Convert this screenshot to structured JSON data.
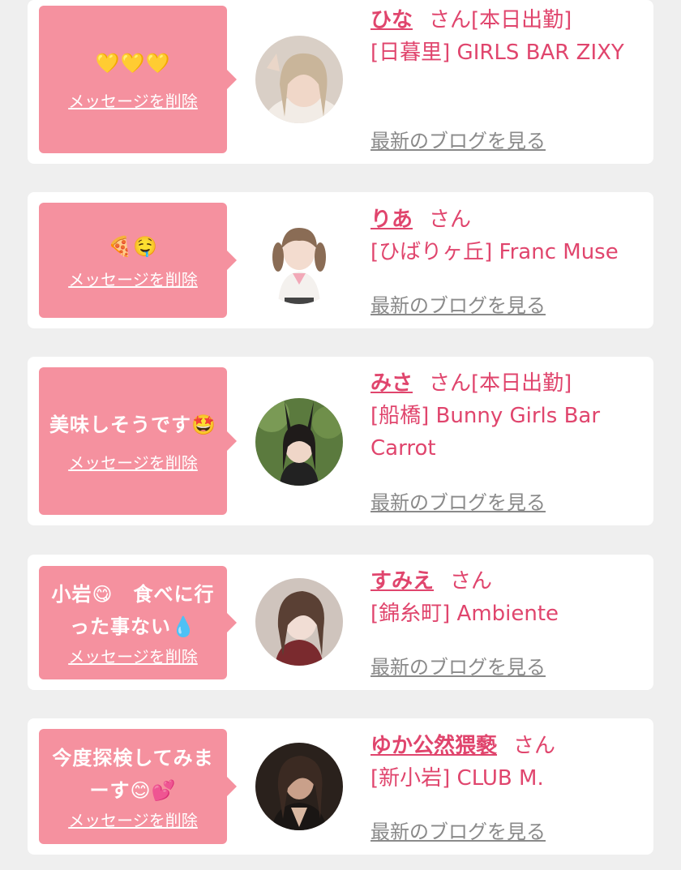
{
  "delete_label": "メッセージを削除",
  "blog_label": "最新のブログを見る",
  "honorific": "さん",
  "colors": {
    "accent": "#e0456d",
    "bubble": "#f5919f",
    "background": "#efefef"
  },
  "entries": [
    {
      "message": "💛💛💛",
      "name": "ひな",
      "status": "[本日出勤]",
      "shop": "[日暮里] GIRLS BAR ZIXY"
    },
    {
      "message": "🍕🤤",
      "name": "りあ",
      "status": "",
      "shop": "[ひばりヶ丘] Franc Muse"
    },
    {
      "message": "美味しそうです🤩",
      "name": "みさ",
      "status": "[本日出勤]",
      "shop": "[船橋] Bunny Girls Bar Carrot"
    },
    {
      "message": "小岩😋　食べに行った事ない💧",
      "name": "すみえ",
      "status": "",
      "shop": "[錦糸町] Ambiente"
    },
    {
      "message": "今度探検してみまーす😊💕",
      "name": "ゆか公然猥褻",
      "status": "",
      "shop": "[新小岩] CLUB M."
    }
  ]
}
